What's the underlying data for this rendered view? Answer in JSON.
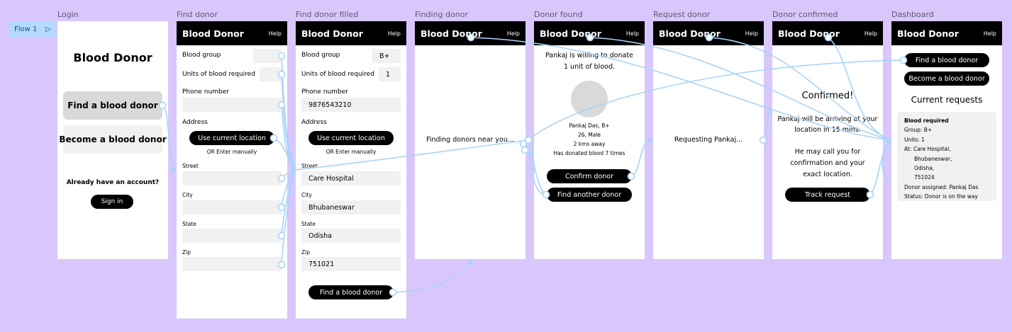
{
  "flow": {
    "label": "Flow 1"
  },
  "frames": {
    "login": {
      "label": "Login",
      "title": "Blood Donor",
      "find_btn": "Find a blood donor",
      "become_btn": "Become a blood donor",
      "account_q": "Already have an account?",
      "signin": "Sign in"
    },
    "find": {
      "label": "Find donor",
      "title": "Blood Donor",
      "help": "Help",
      "blood_group": "Blood group",
      "units": "Units of blood required",
      "phone": "Phone number",
      "address": "Address",
      "use_loc": "Use current location",
      "or_manual": "OR Enter manually",
      "street": "Street",
      "city": "City",
      "state": "State",
      "zip": "Zip"
    },
    "filled": {
      "label": "Find donor filled",
      "title": "Blood Donor",
      "help": "Help",
      "blood_group": "Blood group",
      "blood_group_val": "B+",
      "units": "Units of blood required",
      "units_val": "1",
      "phone": "Phone number",
      "phone_val": "9876543210",
      "address": "Address",
      "use_loc": "Use current location",
      "or_manual": "OR Enter manually",
      "street": "Street",
      "street_val": "Care Hospital",
      "city": "City",
      "city_val": "Bhubaneswar",
      "state": "State",
      "state_val": "Odisha",
      "zip": "Zip",
      "zip_val": "751021",
      "find_btn": "Find a blood donor"
    },
    "finding": {
      "label": "Finding donor",
      "title": "Blood Donor",
      "help": "Help",
      "msg": "Finding donors near you..."
    },
    "found": {
      "label": "Donor found",
      "title": "Blood Donor",
      "help": "Help",
      "msg1": "Pankaj is willing to donate",
      "msg2": "1 unit of blood.",
      "d1": "Pankaj Das, B+",
      "d2": "26, Male",
      "d3": "2 kms away",
      "d4": "Has donated blood 7 times",
      "confirm_btn": "Confirm donor",
      "another_btn": "Find another donor"
    },
    "request": {
      "label": "Request donor",
      "title": "Blood Donor",
      "help": "Help",
      "msg": "Requesting Pankaj..."
    },
    "confirmed": {
      "label": "Donor confirmed",
      "title": "Blood Donor",
      "help": "Help",
      "heading": "Confirmed!",
      "l1": "Pankaj will be arriving at your",
      "l2": "location in 15 mins.",
      "l3": "He may call you for",
      "l4": "confirmation and your",
      "l5": "exact location.",
      "track_btn": "Track request"
    },
    "dashboard": {
      "label": "Dashboard",
      "title": "Blood Donor",
      "help": "Help",
      "find_btn": "Find a blood donor",
      "become_btn": "Become a blood donor",
      "current": "Current requests",
      "card_title": "Blood required",
      "group": "Group: B+",
      "units": "Units: 1",
      "at1": "At: Care Hospital,",
      "at2": "Bhubaneswar,",
      "at3": "Odisha,",
      "at4": "751024",
      "assigned": "Donor assigned: Pankaj Das",
      "status": "Status: Donor is on the way"
    }
  },
  "colors": {
    "canvas": "#d9c7fc",
    "connector": "#a9d3f9",
    "flow_tag": "#b3dafe"
  }
}
